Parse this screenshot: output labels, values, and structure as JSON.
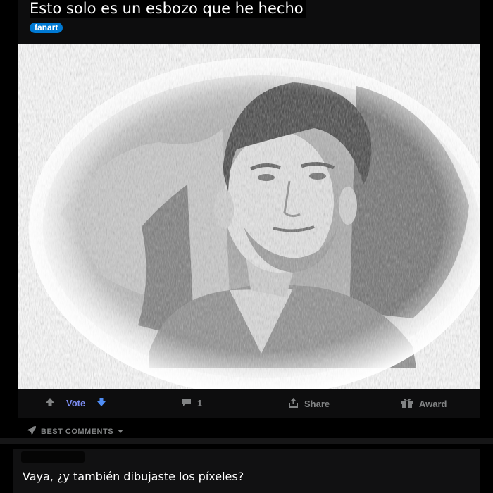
{
  "post": {
    "title": "Esto solo es un esbozo que he hecho",
    "flair": "fanart"
  },
  "actions": {
    "vote_label": "Vote",
    "comment_count": "1",
    "share_label": "Share",
    "award_label": "Award"
  },
  "comments_section": {
    "sort_label": "BEST COMMENTS"
  },
  "comment": {
    "text": "Vaya, ¿y también dibujaste los píxeles?"
  },
  "colors": {
    "accent_blue": "#0079d3",
    "vote_blue": "#7b8cf0",
    "background": "#000000"
  }
}
